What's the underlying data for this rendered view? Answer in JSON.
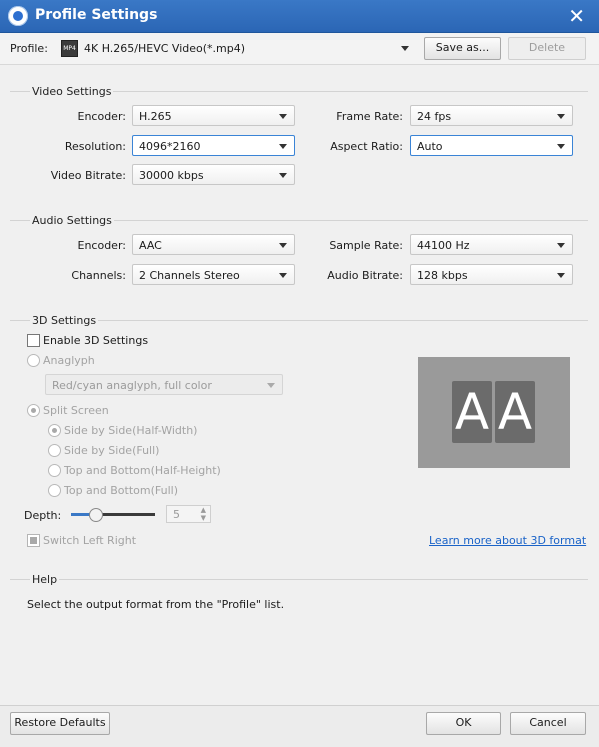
{
  "window": {
    "title": "Profile Settings"
  },
  "profile": {
    "label": "Profile:",
    "value": "4K H.265/HEVC Video(*.mp4)",
    "icon": "mp4-file-icon",
    "save_as": "Save as...",
    "delete": "Delete"
  },
  "video": {
    "title": "Video Settings",
    "encoder_label": "Encoder:",
    "encoder": "H.265",
    "resolution_label": "Resolution:",
    "resolution": "4096*2160",
    "bitrate_label": "Video Bitrate:",
    "bitrate": "30000 kbps",
    "framerate_label": "Frame Rate:",
    "framerate": "24 fps",
    "aspect_label": "Aspect Ratio:",
    "aspect": "Auto"
  },
  "audio": {
    "title": "Audio Settings",
    "encoder_label": "Encoder:",
    "encoder": "AAC",
    "channels_label": "Channels:",
    "channels": "2 Channels Stereo",
    "samplerate_label": "Sample Rate:",
    "samplerate": "44100 Hz",
    "bitrate_label": "Audio Bitrate:",
    "bitrate": "128 kbps"
  },
  "three_d": {
    "title": "3D Settings",
    "enable_label": "Enable 3D Settings",
    "anaglyph_label": "Anaglyph",
    "anaglyph_value": "Red/cyan anaglyph, full color",
    "split_label": "Split Screen",
    "options": [
      "Side by Side(Half-Width)",
      "Side by Side(Full)",
      "Top and Bottom(Half-Height)",
      "Top and Bottom(Full)"
    ],
    "depth_label": "Depth:",
    "depth_value": "5",
    "switch_label": "Switch Left Right",
    "learn_more": "Learn more about 3D format",
    "preview_left": "A",
    "preview_right": "A"
  },
  "help": {
    "title": "Help",
    "text": "Select the output format from the \"Profile\" list."
  },
  "footer": {
    "restore": "Restore Defaults",
    "ok": "OK",
    "cancel": "Cancel"
  },
  "colors": {
    "titlebar": "#2b66b5",
    "link": "#1a63c8",
    "focus_border": "#3a84d6"
  }
}
